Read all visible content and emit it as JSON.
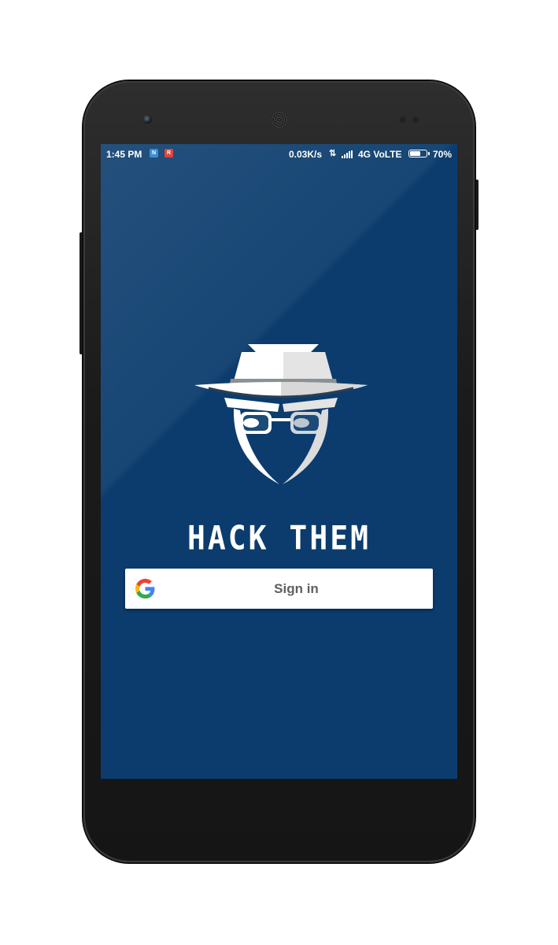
{
  "status_bar": {
    "time": "1:45 PM",
    "notification_a": "N",
    "notification_b": "R",
    "net_speed": "0.03K/s",
    "data_arrows": "⇅",
    "network": "4G VoLTE",
    "battery_percent": "70%",
    "battery_level": 0.7
  },
  "app": {
    "title": "HACK THEM",
    "logo_icon": "spy-hat-icon"
  },
  "signin": {
    "label": "Sign in",
    "icon": "google-g-icon"
  },
  "colors": {
    "screen_background": "#0b3c6d",
    "button_background": "#ffffff",
    "button_text": "#5f5f5f"
  }
}
